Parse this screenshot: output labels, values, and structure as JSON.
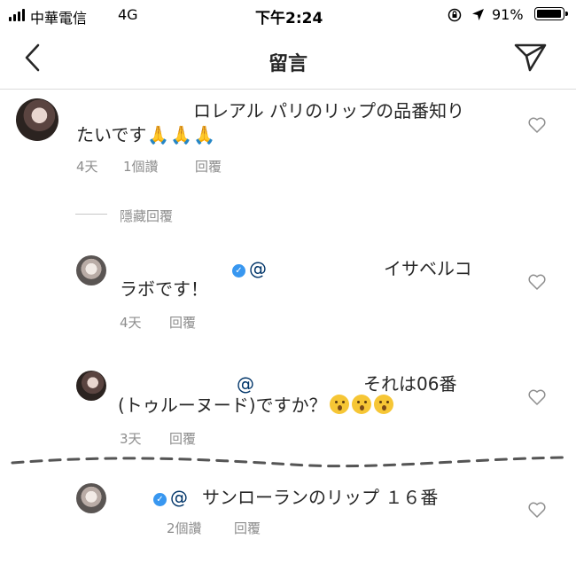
{
  "status_bar": {
    "carrier": "中華電信",
    "network": "4G",
    "time": "下午2:24",
    "battery": "91%"
  },
  "nav": {
    "back_icon": "chevron-left-icon",
    "title": "留言",
    "send_icon": "paper-plane-icon"
  },
  "comments": [
    {
      "text_line1": "ロレアル パリのリップの品番知り",
      "text_line2": "たいです",
      "emoji": [
        "🙏",
        "🙏",
        "🙏"
      ],
      "age": "4天",
      "likes": "1個讚",
      "reply": "回覆"
    }
  ],
  "hide_replies": "隱藏回覆",
  "replies": [
    {
      "mention": "@",
      "text_line1": "イサベルコ",
      "text_line2": "ラボです！",
      "age": "4天",
      "reply": "回覆"
    },
    {
      "mention": "@",
      "text_line1": "それは06番",
      "text_line2": "(トゥルーヌード)ですか？",
      "emoji": [
        "😮",
        "😮",
        "😮"
      ],
      "age": "3天",
      "reply": "回覆"
    },
    {
      "mention": "@",
      "text_line1": "サンローランのリップ １６番",
      "likes": "2個讚",
      "reply": "回覆"
    }
  ],
  "colors": {
    "text": "#262626",
    "meta": "#8e8e8e",
    "verified": "#3897f0"
  }
}
